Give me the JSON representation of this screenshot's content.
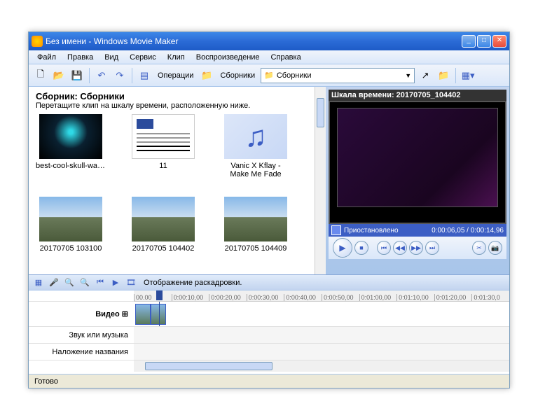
{
  "window": {
    "title": "Без имени - Windows Movie Maker"
  },
  "menu": {
    "file": "Файл",
    "edit": "Правка",
    "view": "Вид",
    "service": "Сервис",
    "clip": "Клип",
    "play": "Воспроизведение",
    "help": "Справка"
  },
  "toolbar": {
    "operations": "Операции",
    "collections": "Сборники",
    "combo_value": "Сборники"
  },
  "collection": {
    "title": "Сборник: Сборники",
    "hint": "Перетащите клип на шкалу времени, расположенную ниже.",
    "items": [
      {
        "label": "best-cool-skull-wallpap..."
      },
      {
        "label": "11"
      },
      {
        "label": "Vanic X Kflay - Make Me Fade"
      },
      {
        "label": "20170705 103100"
      },
      {
        "label": "20170705 104402"
      },
      {
        "label": "20170705 104409"
      }
    ]
  },
  "preview": {
    "title": "Шкала времени: 20170705_104402",
    "status": "Приостановлено",
    "time": "0:00:06,05 / 0:00:14,96"
  },
  "timeline_toolbar": {
    "label": "Отображение раскадровки."
  },
  "timeline": {
    "tracks": {
      "video": "Видео",
      "audio": "Звук или музыка",
      "title": "Наложение названия"
    },
    "ticks": [
      "00.00",
      "0:00:10,00",
      "0:00:20,00",
      "0:00:30,00",
      "0:00:40,00",
      "0:00:50,00",
      "0:01:00,00",
      "0:01:10,00",
      "0:01:20,00",
      "0:01:30,0"
    ]
  },
  "status": {
    "text": "Готово"
  }
}
